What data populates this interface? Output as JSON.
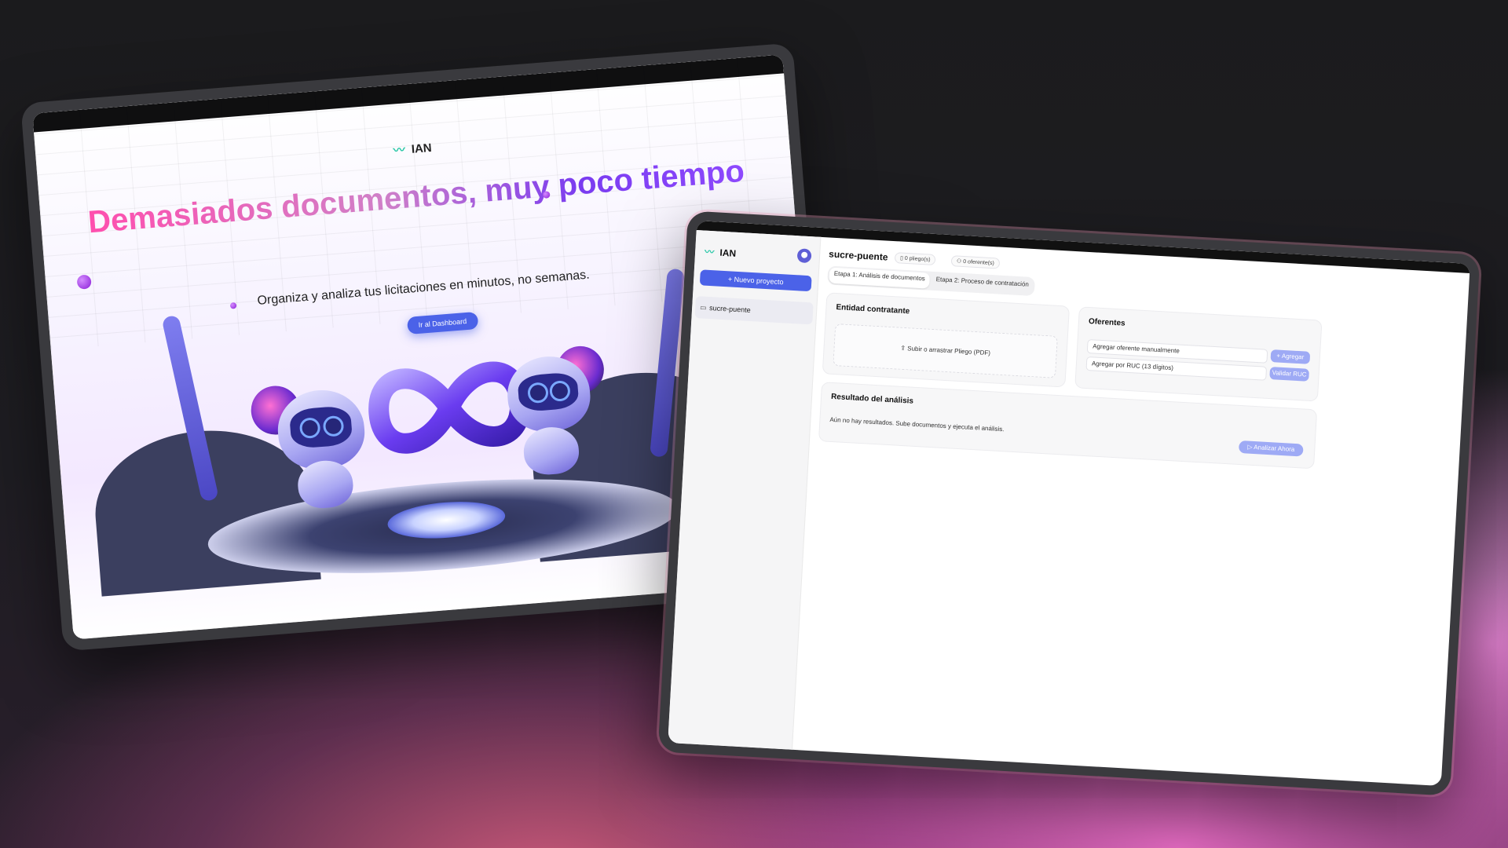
{
  "landing": {
    "logo": "IAN",
    "headline": "Demasiados documentos, muy poco tiempo",
    "subtitle": "Organiza y analiza tus licitaciones en minutos, no semanas.",
    "cta_label": "Ir al Dashboard"
  },
  "dashboard": {
    "logo": "IAN",
    "new_project_label": "Nuevo proyecto",
    "projects": [
      "sucre-puente"
    ],
    "project_title": "sucre-puente",
    "chips": {
      "pliegos": "0 pliego(s)",
      "oferentes": "0 oferente(s)"
    },
    "tabs": [
      "Etapa 1: Análisis de documentos",
      "Etapa 2: Proceso de contratación"
    ],
    "entity_card": {
      "title": "Entidad contratante",
      "upload_label": "Subir o arrastrar Pliego (PDF)"
    },
    "bidders_card": {
      "title": "Oferentes",
      "manual_placeholder": "Agregar oferente manualmente",
      "ruc_placeholder": "Agregar por RUC (13 dígitos)",
      "add_label": "Agregar",
      "validate_label": "Validar RUC"
    },
    "results_card": {
      "title": "Resultado del análisis",
      "empty_text": "Aún no hay resultados. Sube documentos y ejecuta el análisis.",
      "analyze_label": "Analizar Ahora"
    }
  },
  "colors": {
    "accent": "#4b62e8",
    "accent_light": "#9eaaf5",
    "brand_teal": "#2cc8a8"
  }
}
